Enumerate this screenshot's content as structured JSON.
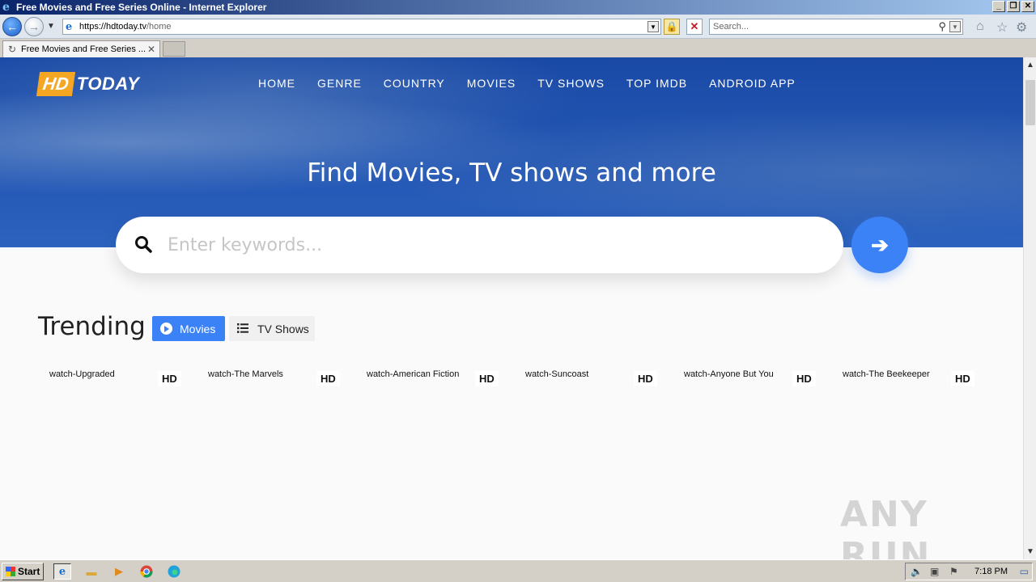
{
  "window": {
    "title": "Free Movies and Free Series Online - Internet Explorer",
    "buttons": [
      "_",
      "❐",
      "✕"
    ]
  },
  "browser": {
    "address": {
      "host": "https://hdtoday.tv",
      "path": "/home"
    },
    "search_placeholder": "Search...",
    "tab_title": "Free Movies and Free Series ...",
    "tab_close": "✕"
  },
  "site": {
    "logo": {
      "hd": "HD",
      "today": "TODAY",
      "hd_color": "#f5a623"
    },
    "nav": [
      "HOME",
      "GENRE",
      "COUNTRY",
      "MOVIES",
      "TV SHOWS",
      "TOP IMDB",
      "ANDROID APP"
    ],
    "hero_title": "Find Movies, TV shows and more",
    "search_placeholder": "Enter keywords...",
    "go_arrow": "➔",
    "accent": "#3b82f6",
    "trending": {
      "title": "Trending",
      "tabs": {
        "movies": "Movies",
        "tv": "TV Shows"
      },
      "items": [
        {
          "title": "watch-Upgraded",
          "badge": "HD"
        },
        {
          "title": "watch-The Marvels",
          "badge": "HD"
        },
        {
          "title": "watch-American Fiction",
          "badge": "HD"
        },
        {
          "title": "watch-Suncoast",
          "badge": "HD"
        },
        {
          "title": "watch-Anyone But You",
          "badge": "HD"
        },
        {
          "title": "watch-The Beekeeper",
          "badge": "HD"
        }
      ]
    }
  },
  "watermark": "ANY RUN",
  "taskbar": {
    "start": "Start",
    "clock": "7:18 PM"
  }
}
